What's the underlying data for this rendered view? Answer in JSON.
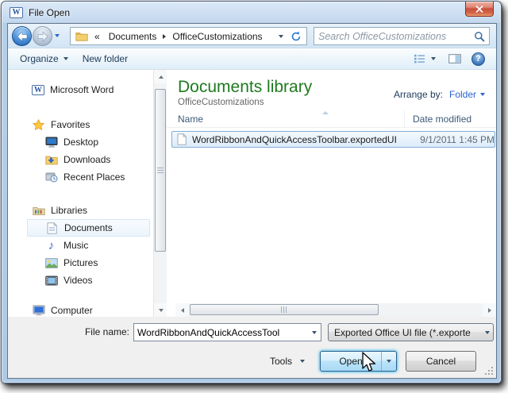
{
  "window": {
    "title": "File Open",
    "app_icon": "word-icon"
  },
  "nav": {
    "breadcrumb": {
      "overflow": "«",
      "items": [
        "Documents",
        "OfficeCustomizations"
      ],
      "icon": "folder-icon"
    },
    "search_placeholder": "Search OfficeCustomizations",
    "icons": [
      "back-icon",
      "forward-icon",
      "refresh-icon",
      "search-icon"
    ]
  },
  "toolbar": {
    "organize_label": "Organize",
    "new_folder_label": "New folder",
    "icons": [
      "views-icon",
      "preview-pane-icon",
      "help-icon"
    ]
  },
  "sidebar": {
    "items": [
      {
        "label": "Microsoft Word",
        "icon": "word-icon",
        "level": 0
      },
      {
        "label": "Favorites",
        "icon": "star-icon",
        "level": 0
      },
      {
        "label": "Desktop",
        "icon": "desktop-icon",
        "level": 1
      },
      {
        "label": "Downloads",
        "icon": "downloads-icon",
        "level": 1
      },
      {
        "label": "Recent Places",
        "icon": "recent-places-icon",
        "level": 1
      },
      {
        "label": "Libraries",
        "icon": "libraries-icon",
        "level": 0
      },
      {
        "label": "Documents",
        "icon": "documents-icon",
        "level": 1,
        "state": "hover"
      },
      {
        "label": "Music",
        "icon": "music-icon",
        "level": 1
      },
      {
        "label": "Pictures",
        "icon": "pictures-icon",
        "level": 1
      },
      {
        "label": "Videos",
        "icon": "videos-icon",
        "level": 1
      },
      {
        "label": "Computer",
        "icon": "computer-icon",
        "level": 0
      }
    ]
  },
  "main": {
    "library_title": "Documents library",
    "library_location": "OfficeCustomizations",
    "arrange_by_label": "Arrange by:",
    "arrange_by_value": "Folder",
    "columns": [
      {
        "label": "Name",
        "sort": "asc"
      },
      {
        "label": "Date modified"
      }
    ],
    "files": [
      {
        "name": "WordRibbonAndQuickAccessToolbar.exportedUI",
        "date_modified": "9/1/2011 1:45 PM",
        "selected": true,
        "icon": "file-icon"
      }
    ]
  },
  "footer": {
    "file_name_label": "File name:",
    "file_name_value": "WordRibbonAndQuickAccessTool",
    "file_type_value": "Exported Office UI file (*.exporte",
    "tools_label": "Tools",
    "open_label": "Open",
    "cancel_label": "Cancel"
  },
  "colors": {
    "library_title_green": "#1e7a1e",
    "link_blue": "#2d62d0",
    "command_text": "#1e395b",
    "selection_border": "#84acd4",
    "titlebar_glass": "#bcd2ea",
    "close_button_red": "#c8503a",
    "open_button_glow": "#55c2f0"
  }
}
